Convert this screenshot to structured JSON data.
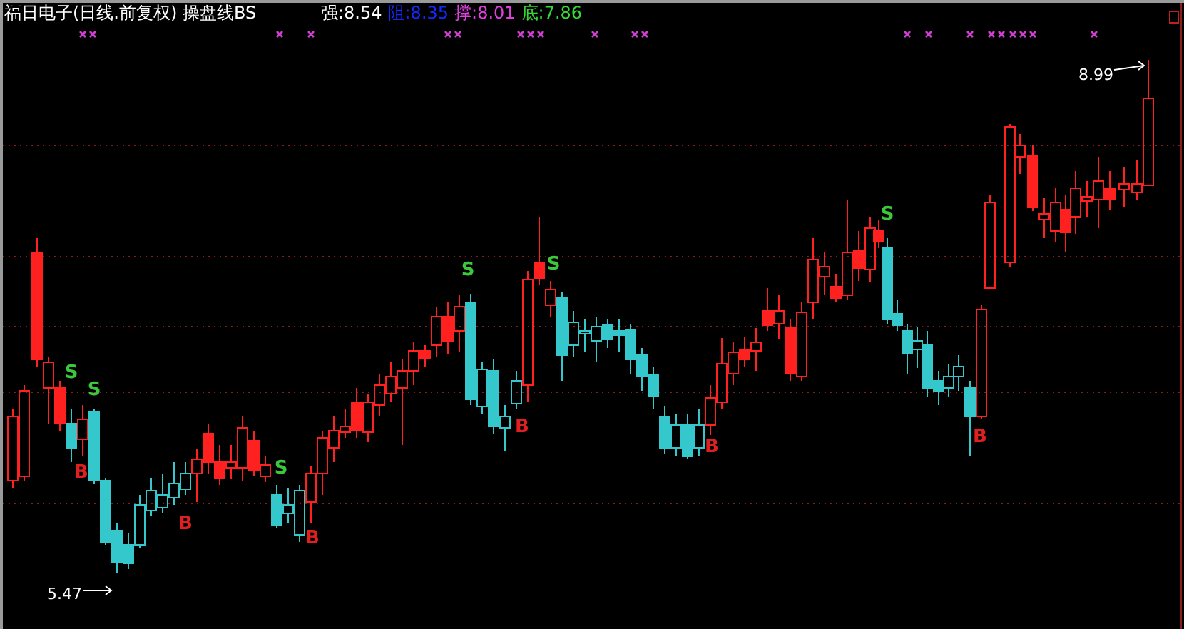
{
  "header": {
    "title": "福日电子(日线.前复权) 操盘线BS",
    "indicators": [
      {
        "label": "强:8.54",
        "color": "#ffffff"
      },
      {
        "label": "阻:8.35",
        "color": "#1428ff"
      },
      {
        "label": "撑:8.01",
        "color": "#e040e0"
      },
      {
        "label": "底:7.86",
        "color": "#36d836"
      }
    ]
  },
  "chart": {
    "signals": [
      {
        "kind": "sell",
        "text": "S"
      },
      {
        "kind": "buy",
        "text": "B"
      },
      {
        "kind": "sell",
        "text": "S"
      },
      {
        "kind": "buy",
        "text": "B"
      },
      {
        "kind": "sell",
        "text": "S"
      },
      {
        "kind": "buy",
        "text": "B"
      },
      {
        "kind": "sell",
        "text": "S"
      },
      {
        "kind": "buy",
        "text": "B"
      },
      {
        "kind": "sell",
        "text": "S"
      },
      {
        "kind": "buy",
        "text": "B"
      },
      {
        "kind": "sell",
        "text": "S"
      },
      {
        "kind": "buy",
        "text": "B"
      }
    ],
    "price_labels": [
      {
        "kind": "low",
        "text": "5.47"
      },
      {
        "kind": "high",
        "text": "8.99"
      }
    ]
  }
}
